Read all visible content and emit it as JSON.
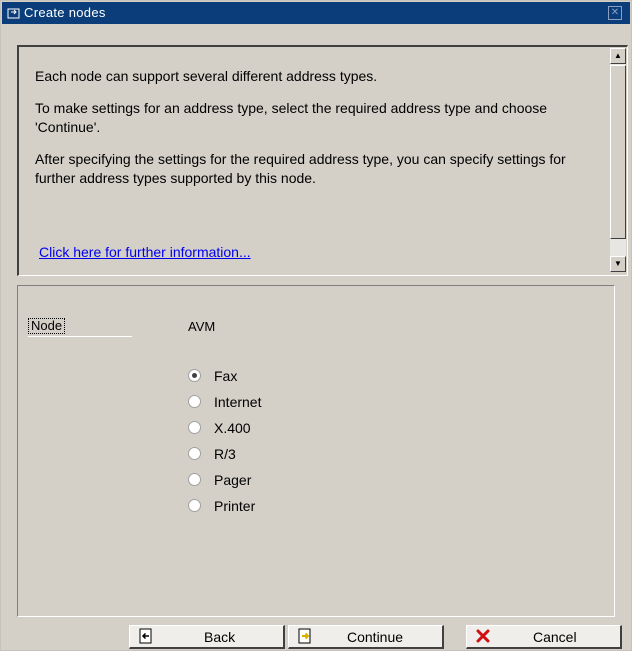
{
  "window": {
    "title": "Create nodes",
    "close_label": "✕"
  },
  "info": {
    "paragraphs": [
      "Each node can support several different address types.",
      "To make settings for an address type, select the required address type and choose 'Continue'.",
      "After specifying the settings for the required address type, you can specify settings for further address types supported by this node."
    ],
    "link": "Click here for further information..."
  },
  "form": {
    "node_label": "Node",
    "node_value": "AVM",
    "address_types": [
      {
        "label": "Fax",
        "selected": true
      },
      {
        "label": "Internet",
        "selected": false
      },
      {
        "label": "X.400",
        "selected": false
      },
      {
        "label": "R/3",
        "selected": false
      },
      {
        "label": "Pager",
        "selected": false
      },
      {
        "label": "Printer",
        "selected": false
      }
    ]
  },
  "buttons": {
    "back": "Back",
    "continue": "Continue",
    "cancel": "Cancel"
  },
  "colors": {
    "titlebar": "#0a3d7a",
    "link": "#0000ee",
    "cancel_icon": "#d01010",
    "continue_icon": "#d8b000"
  }
}
